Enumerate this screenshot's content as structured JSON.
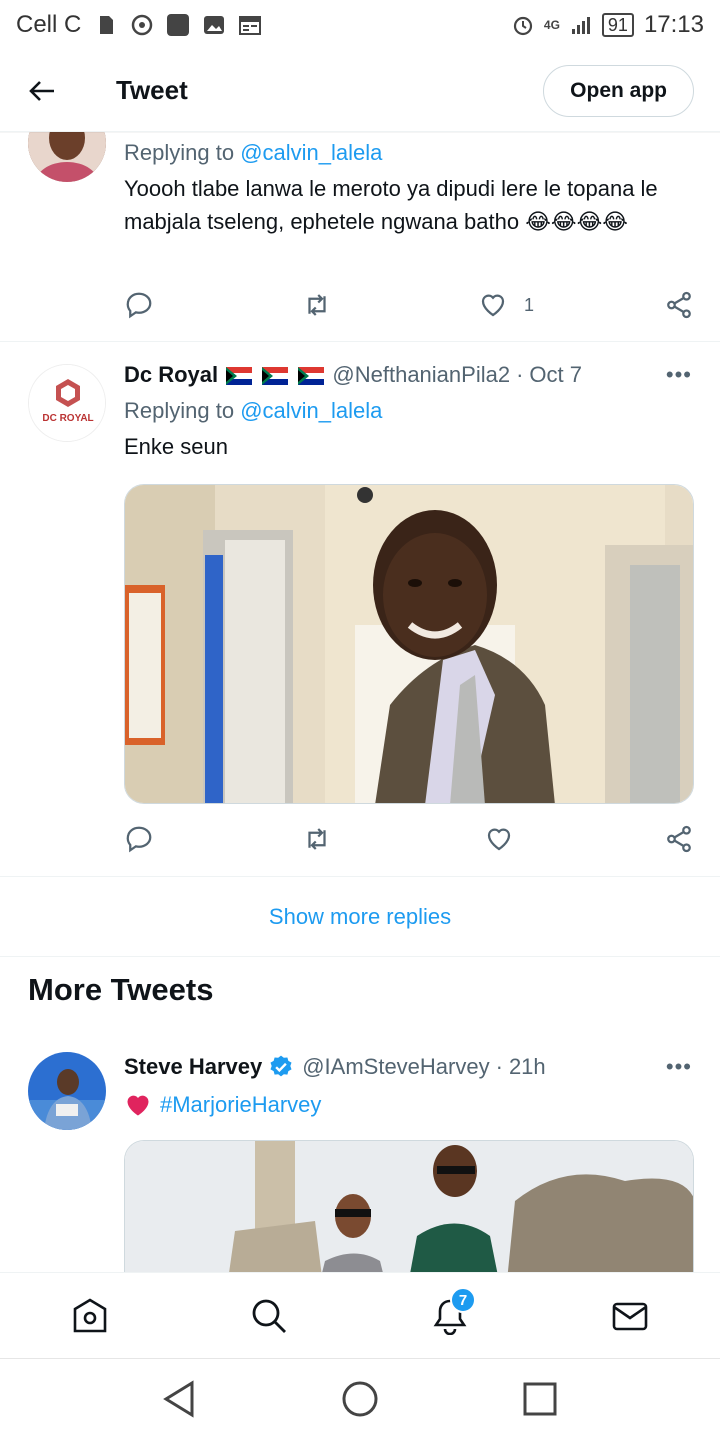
{
  "status_bar": {
    "carrier": "Cell C",
    "network": "4G",
    "battery": "91",
    "time": "17:13"
  },
  "top_bar": {
    "title": "Tweet",
    "open_app_label": "Open app"
  },
  "tweets": [
    {
      "replying_prefix": "Replying to",
      "replying_handle": "@calvin_lalela",
      "text": "Yoooh tlabe lanwa le meroto ya dipudi lere le topana le mabjala tseleng, ephetele ngwana batho 😂😂😂😂",
      "likes": "1"
    },
    {
      "name": "Dc Royal",
      "handle": "@NefthanianPila2",
      "date": "Oct 7",
      "avatar_text": "DC ROYAL",
      "replying_prefix": "Replying to",
      "replying_handle": "@calvin_lalela",
      "text": "Enke seun"
    }
  ],
  "show_more_replies": "Show more replies",
  "more_tweets_heading": "More Tweets",
  "more_tweet": {
    "name": "Steve Harvey",
    "handle": "@IAmSteveHarvey",
    "time": "21h",
    "text": "#MarjorieHarvey"
  },
  "bottom_nav": {
    "notifications_badge": "7"
  },
  "colors": {
    "accent": "#1d9bf0",
    "text": "#0f1419",
    "secondary": "#536471"
  }
}
